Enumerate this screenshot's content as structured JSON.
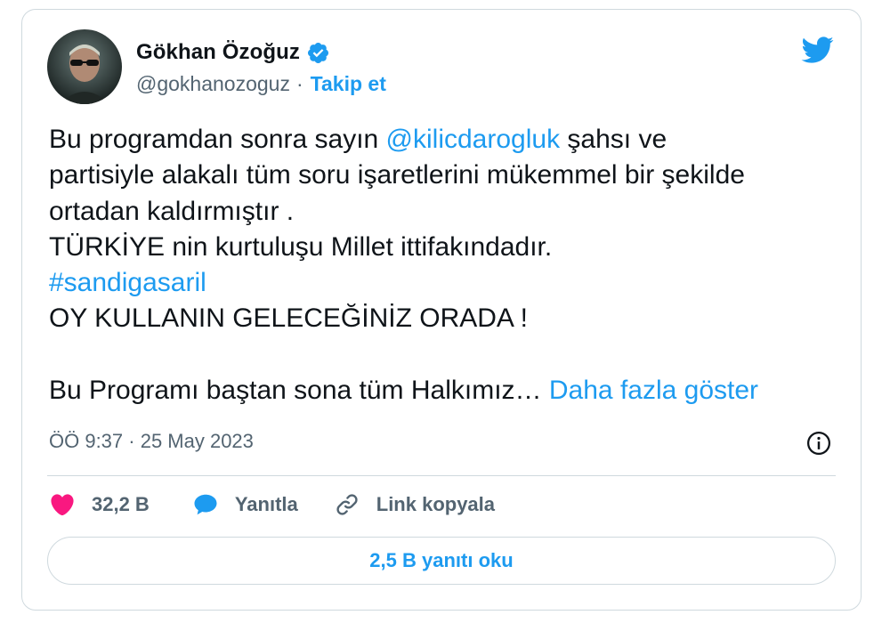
{
  "author": {
    "name": "Gökhan Özoğuz",
    "handle": "@gokhanozoguz",
    "separator": "·",
    "follow_label": "Takip et",
    "verified_icon": "verified-badge-icon",
    "avatar_icon": "avatar"
  },
  "tweet": {
    "line1_prefix": "Bu programdan sonra sayın ",
    "mention": "@kilicdarogluk",
    "line1_suffix": " şahsı ve",
    "line2": "partisiyle alakalı tüm soru işaretlerini mükemmel bir şekilde",
    "line3": "ortadan kaldırmıştır .",
    "line4": "TÜRKİYE nin kurtuluşu Millet ittifakındadır.",
    "hashtag": "#sandigasaril",
    "line6": "OY KULLANIN GELECEĞİNİZ ORADA !",
    "line8_prefix": "Bu Programı baştan sona tüm Halkımız… ",
    "show_more": "Daha fazla göster"
  },
  "meta": {
    "timestamp": "ÖÖ 9:37 · 25 May 2023"
  },
  "actions": {
    "likes": "32,2 B",
    "reply": "Yanıtla",
    "copy_link": "Link kopyala"
  },
  "read_replies": "2,5 B yanıtı oku",
  "colors": {
    "accent": "#1d9bf0",
    "like": "#f91880",
    "text": "#0f1419",
    "secondary": "#536471",
    "border": "#cfd9de"
  }
}
